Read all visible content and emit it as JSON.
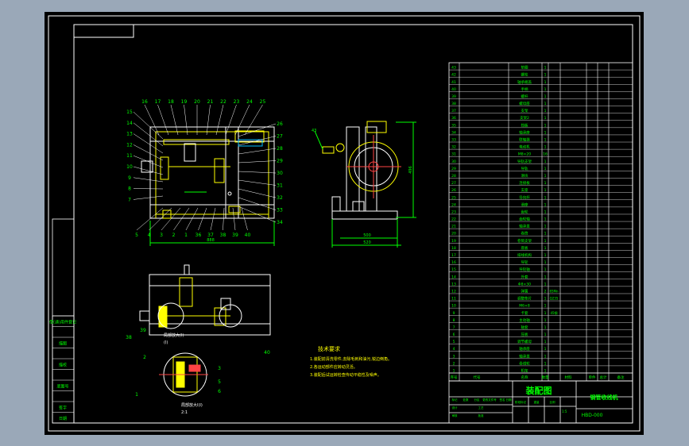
{
  "colors": {
    "background": "#9aa8b8",
    "sheet": "#000000",
    "line": "#ffffff",
    "part": "#ffff00",
    "dimension": "#00ff00",
    "center": "#ff0000",
    "accent": "#00bfff"
  },
  "dimensions": {
    "front_width": "888",
    "side_width_inner": "500",
    "side_width_outer": "520",
    "side_height": "496"
  },
  "front_balloons_top": [
    "16",
    "17",
    "18",
    "19",
    "20",
    "21",
    "22",
    "23",
    "24",
    "25"
  ],
  "front_balloons_left": [
    "15",
    "14",
    "13",
    "12",
    "11",
    "10",
    "9",
    "8",
    "7"
  ],
  "front_balloons_right": [
    "26",
    "27",
    "28",
    "29",
    "30",
    "31",
    "32",
    "33",
    "34"
  ],
  "front_balloons_bottom": [
    "5",
    "4",
    "3",
    "2",
    "1",
    "36",
    "37",
    "38",
    "39",
    "40"
  ],
  "detail": {
    "label_1": "局部放大(I)",
    "label_1b": "(I)",
    "label_2": "局部放大I(I)",
    "scale": "2:1",
    "balloons": [
      "38",
      "39",
      "40",
      "3",
      "5",
      "6",
      "1",
      "2"
    ]
  },
  "tech_requirements": {
    "title": "技术要求",
    "lines": [
      "1.装配前清洗零件,去除毛刺和油污,锐边倒角。",
      "2.各运动部件应转动灵活。",
      "3.装配后试运转检查传动平稳性及噪声。"
    ]
  },
  "left_strip": [
    "借(通)用件登记",
    "",
    "描图",
    "",
    "描校",
    "",
    "底图号",
    "",
    "签字",
    "日期"
  ],
  "bom": {
    "rows": [
      {
        "no": "43",
        "name": "垫圈",
        "qty": "1",
        "spec": ""
      },
      {
        "no": "42",
        "name": "螺栓",
        "qty": "1",
        "spec": ""
      },
      {
        "no": "41",
        "name": "轴承端盖",
        "qty": "1",
        "spec": ""
      },
      {
        "no": "40",
        "name": "手柄",
        "qty": "1",
        "spec": ""
      },
      {
        "no": "39",
        "name": "螺杆",
        "qty": "1",
        "spec": ""
      },
      {
        "no": "38",
        "name": "螺母座",
        "qty": "1",
        "spec": ""
      },
      {
        "no": "37",
        "name": "支架",
        "qty": "1",
        "spec": ""
      },
      {
        "no": "36",
        "name": "支架2",
        "qty": "1",
        "spec": ""
      },
      {
        "no": "35",
        "name": "挡板",
        "qty": "1",
        "spec": ""
      },
      {
        "no": "34",
        "name": "轴承座",
        "qty": "1",
        "spec": ""
      },
      {
        "no": "33",
        "name": "联轴器",
        "qty": "1",
        "spec": ""
      },
      {
        "no": "32",
        "name": "电动机",
        "qty": "1",
        "spec": ""
      },
      {
        "no": "31",
        "name": "M8×20",
        "qty": "16",
        "spec": ""
      },
      {
        "no": "30",
        "name": "导轨支架",
        "qty": "1",
        "spec": ""
      },
      {
        "no": "29",
        "name": "导轨",
        "qty": "1",
        "spec": ""
      },
      {
        "no": "28",
        "name": "滑块",
        "qty": "1",
        "spec": ""
      },
      {
        "no": "27",
        "name": "连接板",
        "qty": "1",
        "spec": ""
      },
      {
        "no": "26",
        "name": "支座",
        "qty": "1",
        "spec": ""
      },
      {
        "no": "25",
        "name": "导向杆",
        "qty": "1",
        "spec": ""
      },
      {
        "no": "24",
        "name": "滑座",
        "qty": "1",
        "spec": ""
      },
      {
        "no": "23",
        "name": "齿轮",
        "qty": "1",
        "spec": ""
      },
      {
        "no": "22",
        "name": "齿轮轴",
        "qty": "1",
        "spec": ""
      },
      {
        "no": "21",
        "name": "轴承盖",
        "qty": "1",
        "spec": ""
      },
      {
        "no": "20",
        "name": "卷筒",
        "qty": "1",
        "spec": ""
      },
      {
        "no": "19",
        "name": "卷筒支架",
        "qty": "1",
        "spec": ""
      },
      {
        "no": "18",
        "name": "底板",
        "qty": "1",
        "spec": ""
      },
      {
        "no": "17",
        "name": "排线机构",
        "qty": "1",
        "spec": ""
      },
      {
        "no": "16",
        "name": "导轮",
        "qty": "1",
        "spec": ""
      },
      {
        "no": "15",
        "name": "导轮轴",
        "qty": "1",
        "spec": ""
      },
      {
        "no": "14",
        "name": "外套",
        "qty": "1",
        "spec": ""
      },
      {
        "no": "13",
        "name": "Φ8×30",
        "qty": "1",
        "spec": ""
      },
      {
        "no": "12",
        "name": "弹簧",
        "qty": "2",
        "spec": "65Mn"
      },
      {
        "no": "11",
        "name": "调整垫片",
        "qty": "1",
        "spec": "Q235"
      },
      {
        "no": "10",
        "name": "M6×8",
        "qty": "1",
        "spec": ""
      },
      {
        "no": "9",
        "name": "卡套",
        "qty": "1",
        "spec": "45钢"
      },
      {
        "no": "8",
        "name": "主动轴",
        "qty": "1",
        "spec": ""
      },
      {
        "no": "7",
        "name": "轴套",
        "qty": "1",
        "spec": ""
      },
      {
        "no": "6",
        "name": "压板",
        "qty": "1",
        "spec": ""
      },
      {
        "no": "5",
        "name": "调节螺母",
        "qty": "1",
        "spec": ""
      },
      {
        "no": "4",
        "name": "轴承座",
        "qty": "1",
        "spec": ""
      },
      {
        "no": "3",
        "name": "轴承盖",
        "qty": "1",
        "spec": ""
      },
      {
        "no": "2",
        "name": "卷线轮",
        "qty": "1",
        "spec": ""
      },
      {
        "no": "1",
        "name": "机架",
        "qty": "1",
        "spec": ""
      }
    ],
    "headers": [
      "序号",
      "代号",
      "名称",
      "数量",
      "材料",
      "单件",
      "总计",
      "备注"
    ]
  },
  "title_block": {
    "drawing_type": "装配图",
    "title": "钢管收线机",
    "code": "HBD-000",
    "small_labels": [
      "标记",
      "处数",
      "分区",
      "更改文件号",
      "签名",
      "日期",
      "设计",
      "审核",
      "工艺",
      "批准",
      "阶段标记",
      "重量",
      "比例"
    ],
    "scale": "1:5"
  }
}
